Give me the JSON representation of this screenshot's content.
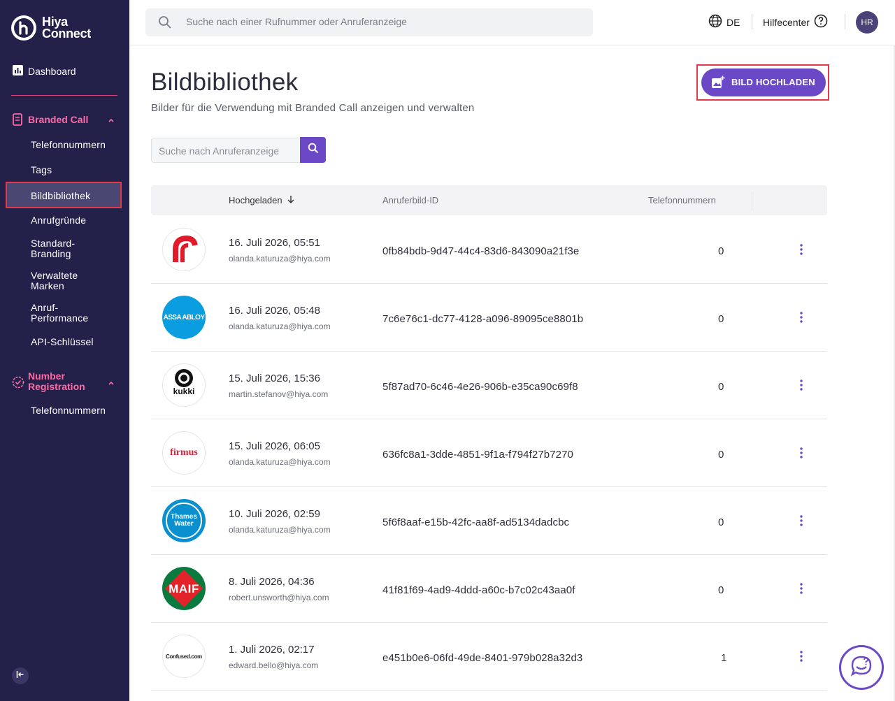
{
  "brand": {
    "line1": "Hiya",
    "line2": "Connect"
  },
  "sidebar": {
    "dashboard": "Dashboard",
    "branded_call": {
      "label": "Branded Call",
      "items": [
        "Telefonnummern",
        "Tags",
        "Bildbibliothek",
        "Anrufgründe",
        "Standard-Branding",
        "Verwaltete Marken",
        "Anruf-Performance",
        "API-Schlüssel"
      ]
    },
    "number_registration": {
      "label": "Number Registration",
      "items": [
        "Telefonnummern"
      ]
    }
  },
  "topbar": {
    "search_placeholder": "Suche nach einer Rufnummer oder Anruferanzeige",
    "language": "DE",
    "help": "Hilfecenter",
    "avatar_initials": "HR"
  },
  "page": {
    "title": "Bildbibliothek",
    "subtitle": "Bilder für die Verwendung mit Branded Call anzeigen und verwalten",
    "upload_label": "BILD HOCHLADEN",
    "filter_placeholder": "Suche nach Anruferanzeige"
  },
  "table": {
    "headers": {
      "uploaded": "Hochgeladen",
      "image_id": "Anruferbild-ID",
      "phone_numbers": "Telefonnummern"
    },
    "rows": [
      {
        "date": "16. Juli 2026, 05:51",
        "email": "olanda.katuruza@hiya.com",
        "id": "0fb84bdb-9d47-44c4-83d6-843090a21f3e",
        "count": "0",
        "logo": "red-r-logo"
      },
      {
        "date": "16. Juli 2026, 05:48",
        "email": "olanda.katuruza@hiya.com",
        "id": "7c6e76c1-dc77-4128-a096-89095ce8801b",
        "count": "0",
        "logo": "assa-abloy-logo",
        "logo_text": "ASSA ABLOY"
      },
      {
        "date": "15. Juli 2026, 15:36",
        "email": "martin.stefanov@hiya.com",
        "id": "5f87ad70-6c46-4e26-906b-e35ca90c69f8",
        "count": "0",
        "logo": "kukki-logo",
        "logo_text": "kukki"
      },
      {
        "date": "15. Juli 2026, 06:05",
        "email": "olanda.katuruza@hiya.com",
        "id": "636fc8a1-3dde-4851-9f1a-f794f27b7270",
        "count": "0",
        "logo": "firmus-logo",
        "logo_text": "firmus"
      },
      {
        "date": "10. Juli 2026, 02:59",
        "email": "olanda.katuruza@hiya.com",
        "id": "5f6f8aaf-e15b-42fc-aa8f-ad5134dadcbc",
        "count": "0",
        "logo": "thames-water-logo",
        "logo_text": "Thames Water"
      },
      {
        "date": "8. Juli 2026, 04:36",
        "email": "robert.unsworth@hiya.com",
        "id": "41f81f69-4ad9-4ddd-a60c-b7c02c43aa0f",
        "count": "0",
        "logo": "maif-logo",
        "logo_text": "MAIF"
      },
      {
        "date": "1. Juli 2026, 02:17",
        "email": "edward.bello@hiya.com",
        "id": "e451b0e6-06fd-49de-8401-979b028a32d3",
        "count": "1",
        "logo": "confused-logo",
        "logo_text": "Confused.com"
      }
    ]
  },
  "colors": {
    "sidebar_bg": "#23204a",
    "accent": "#6b48c6",
    "section_pink": "#ff6aa5",
    "highlight_red": "#e23a4a"
  }
}
